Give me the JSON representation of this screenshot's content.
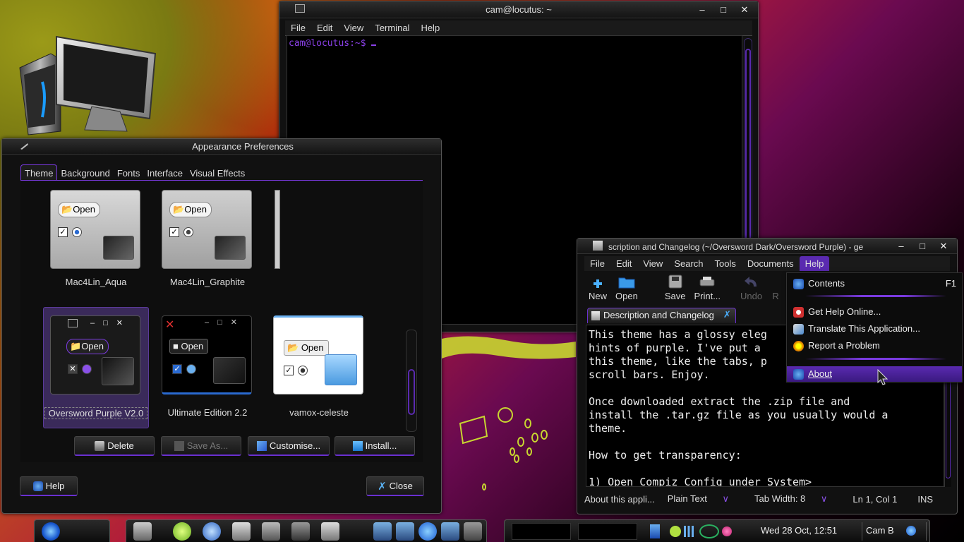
{
  "terminal": {
    "title": "cam@locutus: ~",
    "menu": [
      "File",
      "Edit",
      "View",
      "Terminal",
      "Help"
    ],
    "prompt": "cam@locutus:~$ "
  },
  "appearance": {
    "title": "Appearance Preferences",
    "tabs": [
      "Theme",
      "Background",
      "Fonts",
      "Interface",
      "Visual Effects"
    ],
    "themes": [
      {
        "name": "Mac4Lin_Aqua",
        "button": "Open"
      },
      {
        "name": "Mac4Lin_Graphite",
        "button": "Open"
      },
      {
        "name": "Oversword Purple V2.0",
        "button": "Open"
      },
      {
        "name": "Ultimate Edition 2.2",
        "button": "Open"
      },
      {
        "name": "vamox-celeste",
        "button": "Open"
      }
    ],
    "buttons": {
      "delete": "Delete",
      "save_as": "Save As...",
      "customise": "Customise...",
      "install": "Install...",
      "help": "Help",
      "close": "Close"
    },
    "colors": {
      "accent": "#7a3ae0"
    }
  },
  "gedit": {
    "title": "scription and Changelog (~/Oversword Dark/Oversword Purple) - ge",
    "menu": [
      "File",
      "Edit",
      "View",
      "Search",
      "Tools",
      "Documents",
      "Help"
    ],
    "toolbar": [
      "New",
      "Open",
      "Save",
      "Print...",
      "Undo",
      "R"
    ],
    "doc_tab": "Description and Changelog",
    "lines": [
      "This theme has a glossy eleg",
      "hints of purple. I've put a ",
      "this theme, like the tabs, p",
      "scroll bars. Enjoy.",
      "",
      "Once downloaded extract the .zip file and",
      "install the .tar.gz file as you usually would a",
      "theme.",
      "",
      "How to get transparency:",
      "",
      "1) Open Compiz Config under System>"
    ],
    "status": {
      "msg": "About this appli...",
      "lang": "Plain Text",
      "tab_width": "Tab Width:  8",
      "pos": "Ln 1, Col 1",
      "mode": "INS"
    }
  },
  "help_menu": {
    "items": [
      {
        "label": "Contents",
        "accel": "F1"
      },
      {
        "label": "Get Help Online..."
      },
      {
        "label": "Translate This Application..."
      },
      {
        "label": "Report a Problem"
      },
      {
        "label": "About"
      }
    ]
  },
  "panel": {
    "clock": "Wed 28 Oct, 12:51",
    "user": "Cam B"
  }
}
